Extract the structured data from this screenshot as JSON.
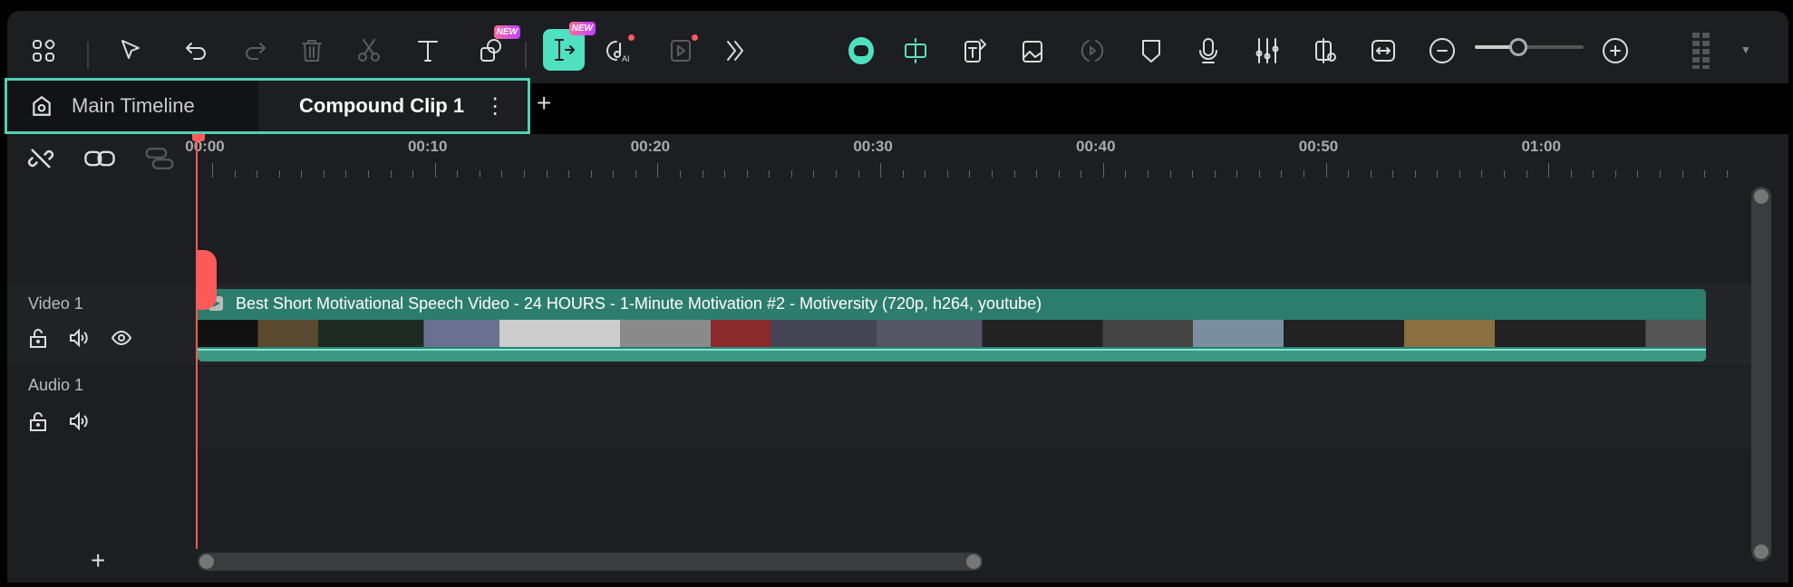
{
  "toolbar": {
    "new_badge": "NEW",
    "left_icons": [
      "apps-grid-icon",
      "select-pointer-icon",
      "undo-icon",
      "redo-icon",
      "delete-icon",
      "cut-icon",
      "text-icon",
      "shapes-icon",
      "compound-clip-icon",
      "ai-music-icon",
      "ai-video-edit-icon",
      "more-chevrons-icon"
    ],
    "right_icons": [
      "ai-assistant-icon",
      "split-scene-icon",
      "text-to-speech-icon",
      "ai-image-icon",
      "speed-ramp-icon",
      "marker-icon",
      "microphone-icon",
      "audio-mixer-icon",
      "preview-render-icon",
      "fit-timeline-icon",
      "zoom-out-icon",
      "zoom-in-icon",
      "layout-grid-icon"
    ],
    "zoom_level": 0.4
  },
  "tabs": {
    "main": "Main Timeline",
    "compound": "Compound Clip 1",
    "add": "+"
  },
  "ruler": [
    "00:00",
    "00:10",
    "00:20",
    "00:30",
    "00:40",
    "00:50",
    "01:00"
  ],
  "tracks": {
    "video": "Video 1",
    "audio": "Audio 1"
  },
  "clip": {
    "title": "Best Short Motivational Speech Video - 24 HOURS - 1-Minute Motivation #2 - Motiversity (720p, h264, youtube)"
  },
  "add_track": "+",
  "colors": {
    "accent": "#4fd1b5",
    "playhead": "#ff5a5a",
    "clip": "#2d7d6c"
  }
}
